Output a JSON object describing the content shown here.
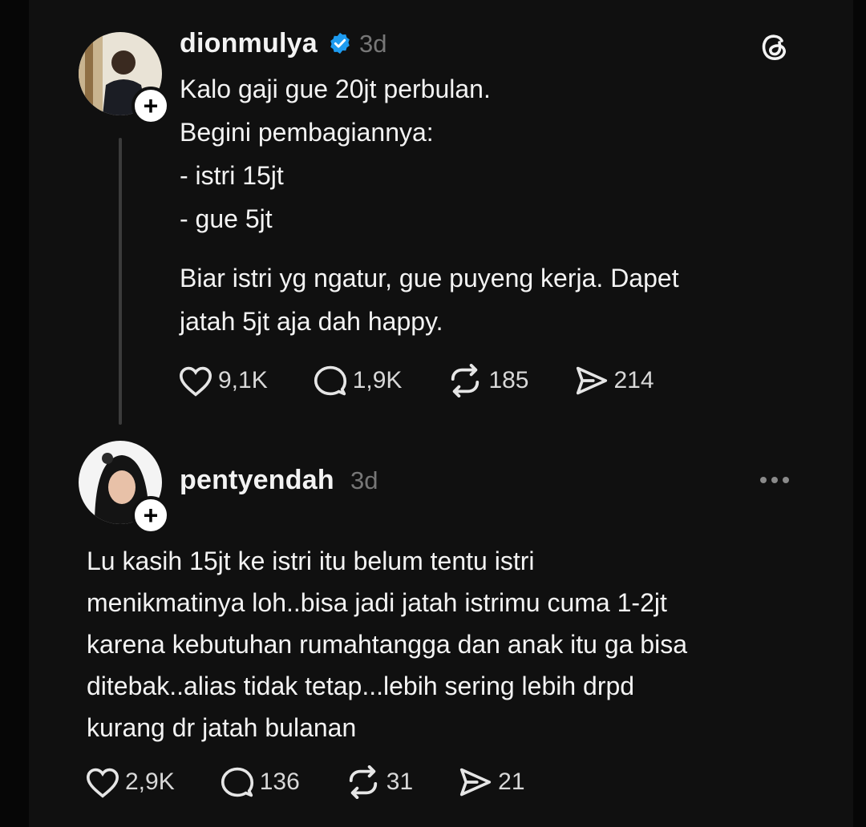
{
  "post": {
    "username": "dionmulya",
    "verified": true,
    "time": "3d",
    "lines": [
      "Kalo gaji gue 20jt perbulan.",
      "Begini pembagiannya:",
      "- istri 15jt",
      "- gue 5jt"
    ],
    "paragraph2": [
      "Biar istri yg ngatur, gue puyeng kerja. Dapet",
      "jatah 5jt aja dah happy."
    ],
    "likes": "9,1K",
    "replies": "1,9K",
    "reposts": "185",
    "shares": "214"
  },
  "reply": {
    "username": "pentyendah",
    "time": "3d",
    "lines": [
      "Lu kasih 15jt ke istri itu belum tentu istri",
      "menikmatinya loh..bisa jadi jatah istrimu cuma 1-2jt",
      "karena kebutuhan rumahtangga dan anak itu ga bisa",
      "ditebak..alias tidak tetap...lebih sering lebih drpd",
      "kurang dr jatah bulanan"
    ],
    "likes": "2,9K",
    "replies": "136",
    "reposts": "31",
    "shares": "21"
  },
  "colors": {
    "background": "#101010",
    "verified": "#1d9bf0",
    "muted": "#777777"
  }
}
